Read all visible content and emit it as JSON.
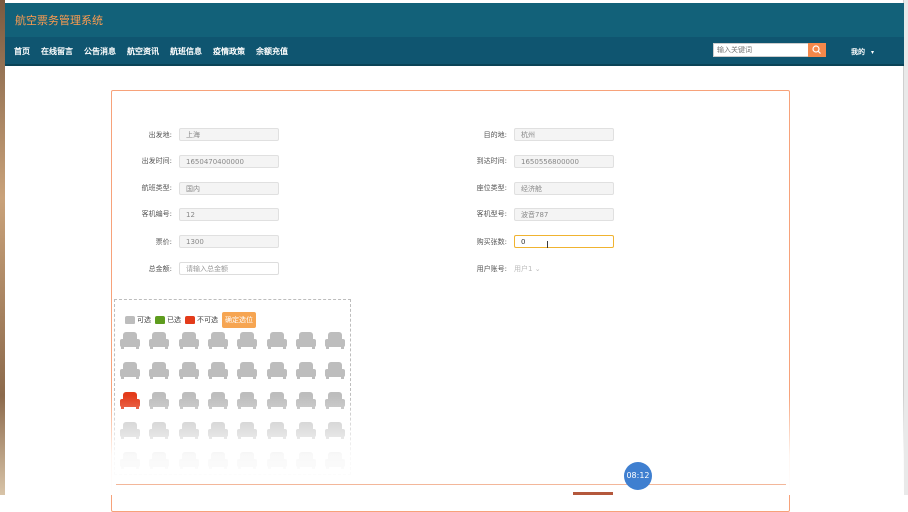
{
  "header": {
    "title": "航空票务管理系统"
  },
  "nav": {
    "items": [
      "首页",
      "在线留言",
      "公告消息",
      "航空资讯",
      "航班信息",
      "疫情政策",
      "余额充值"
    ],
    "search_placeholder": "输入关键词",
    "user_menu": "我的"
  },
  "form": {
    "departure_label": "出发地:",
    "departure_value": "上海",
    "destination_label": "目的地:",
    "destination_value": "杭州",
    "depart_time_label": "出发时间:",
    "depart_time_value": "1650470400000",
    "arrive_time_label": "到达时间:",
    "arrive_time_value": "1650556800000",
    "flight_type_label": "航班类型:",
    "flight_type_value": "国内",
    "cabin_type_label": "座位类型:",
    "cabin_type_value": "经济舱",
    "aircraft_no_label": "客机编号:",
    "aircraft_no_value": "12",
    "aircraft_model_label": "客机型号:",
    "aircraft_model_value": "波音787",
    "price_label": "票价:",
    "price_value": "1300",
    "ticket_count_label": "购买张数:",
    "ticket_count_value": "0",
    "total_label": "总金额:",
    "total_placeholder": "请输入总金额",
    "account_label": "用户账号:",
    "account_value": "用户1"
  },
  "seats": {
    "legend": [
      {
        "label": "可选",
        "color": "#bdbdbd"
      },
      {
        "label": "已选",
        "color": "#5e9c1e"
      },
      {
        "label": "不可选",
        "color": "#e33b1a"
      }
    ],
    "confirm_label": "确定选位",
    "rows": 5,
    "cols": 8,
    "states": [
      [
        "available",
        "available",
        "available",
        "available",
        "available",
        "available",
        "available",
        "available"
      ],
      [
        "available",
        "available",
        "available",
        "available",
        "available",
        "available",
        "available",
        "available"
      ],
      [
        "unavailable",
        "available",
        "available",
        "available",
        "available",
        "available",
        "available",
        "available"
      ],
      [
        "available",
        "available",
        "available",
        "available",
        "available",
        "available",
        "available",
        "available"
      ],
      [
        "available",
        "available",
        "available",
        "available",
        "available",
        "available",
        "available",
        "available"
      ]
    ]
  },
  "timer": "08:12",
  "colors": {
    "header_bg": "#126179",
    "nav_bg": "#0f5570",
    "accent": "#f6884a",
    "panel_border": "#f7a27a",
    "seat_available": "#bdbdbd",
    "seat_unavailable": "#e33b1a"
  }
}
